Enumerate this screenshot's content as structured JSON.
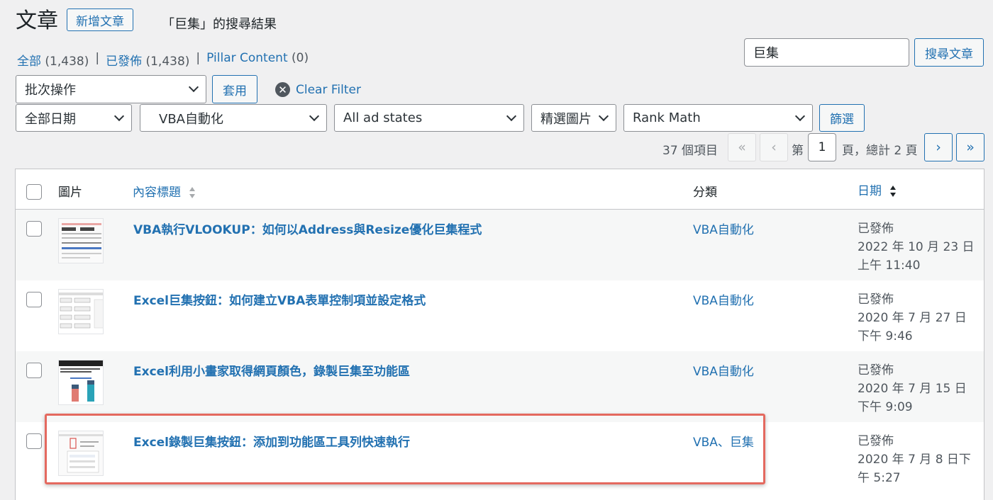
{
  "header": {
    "title": "文章",
    "add_new_label": "新增文章",
    "search_subtitle": "「巨集」的搜尋結果"
  },
  "views": [
    {
      "label": "全部",
      "count": "(1,438)"
    },
    {
      "label": "已發佈",
      "count": "(1,438)"
    },
    {
      "label": "Pillar Content",
      "count": "(0)"
    }
  ],
  "search": {
    "value": "巨集",
    "button_label": "搜尋文章"
  },
  "bulk": {
    "selected": "批次操作",
    "apply_label": "套用",
    "clear_filter_label": "Clear Filter"
  },
  "filters": {
    "date": "全部日期",
    "category": "VBA自動化",
    "ad_states": "All ad states",
    "featured_image": "精選圖片",
    "rank_math": "Rank Math",
    "filter_button_label": "篩選"
  },
  "pagination": {
    "items_count": "37 個項目",
    "first": "«",
    "prev": "‹",
    "page_prefix": "第",
    "current_page": "1",
    "page_suffix": "頁，總計 2 頁",
    "next": "›",
    "last": "»"
  },
  "table": {
    "columns": {
      "image": "圖片",
      "title": "內容標題",
      "category": "分類",
      "date": "日期"
    },
    "rows": [
      {
        "title": "VBA執行VLOOKUP：如何以Address與Resize優化巨集程式",
        "category": "VBA自動化",
        "status": "已發佈",
        "date": "2022 年 10 月 23 日",
        "time": "上午 11:40"
      },
      {
        "title": "Excel巨集按鈕：如何建立VBA表單控制項並設定格式",
        "category": "VBA自動化",
        "status": "已發佈",
        "date": "2020 年 7 月 27 日",
        "time": "下午 9:46"
      },
      {
        "title": "Excel利用小畫家取得網頁顏色，錄製巨集至功能區",
        "category": "VBA自動化",
        "status": "已發佈",
        "date": "2020 年 7 月 15 日",
        "time": "下午 9:09"
      },
      {
        "title": "Excel錄製巨集按鈕：添加到功能區工具列快速執行",
        "category": "VBA、巨集",
        "status": "已發佈",
        "date": "2020 年 7 月 8 日下",
        "time": "午 5:27"
      }
    ]
  },
  "colors": {
    "link": "#2271b1",
    "highlight": "#e4695f"
  }
}
